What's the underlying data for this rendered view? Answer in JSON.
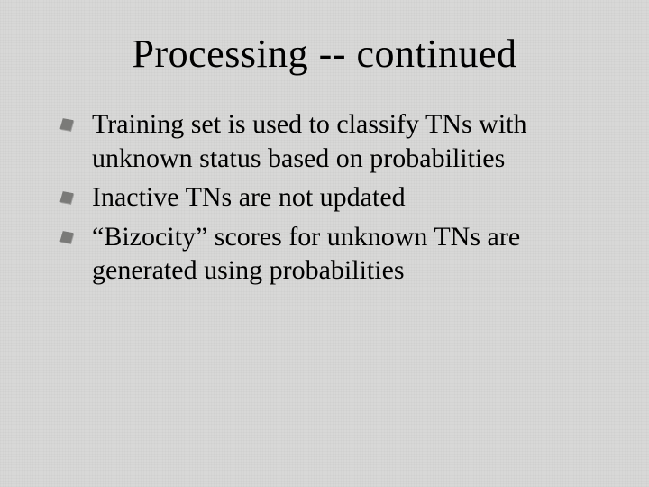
{
  "slide": {
    "title": "Processing -- continued",
    "bullets": [
      "Training set is used to classify TNs with unknown status based on probabilities",
      "Inactive TNs are not updated",
      "“Bizocity” scores for unknown TNs are generated using probabilities"
    ]
  }
}
